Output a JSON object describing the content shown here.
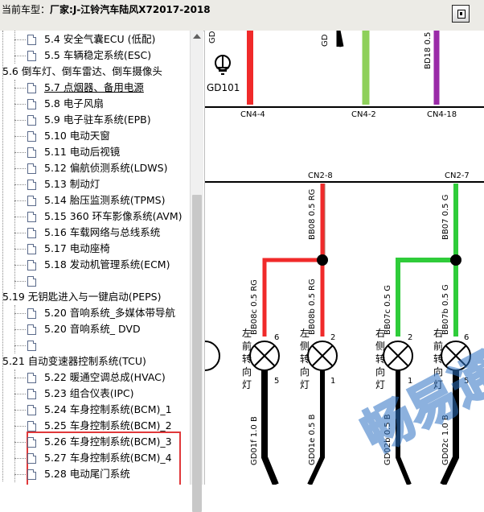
{
  "window": {
    "title_prefix": "当前车型：",
    "title_vehicle": "厂家:J-江铃汽车陆风X72017-2018"
  },
  "tree": [
    {
      "label": "5.4 安全气囊ECU (低配)",
      "indent": 2,
      "y": 0
    },
    {
      "label": "5.5 车辆稳定系统(ESC)",
      "indent": 2,
      "y": 1
    },
    {
      "label": "5.6 倒车灯、倒车雷达、倒车摄像头",
      "indent": 0,
      "y": 2
    },
    {
      "label": "5.7 点烟器、备用电源",
      "indent": 2,
      "y": 3
    },
    {
      "label": "5.8 电子风扇",
      "indent": 2,
      "y": 4
    },
    {
      "label": "5.9 电子驻车系统(EPB)",
      "indent": 2,
      "y": 5
    },
    {
      "label": "5.10 电动天窗",
      "indent": 2,
      "y": 6
    },
    {
      "label": "5.11 电动后视镜",
      "indent": 2,
      "y": 7
    },
    {
      "label": "5.12 偏航侦测系统(LDWS)",
      "indent": 2,
      "y": 8
    },
    {
      "label": "5.13 制动灯",
      "indent": 2,
      "y": 9
    },
    {
      "label": "5.14 胎压监测系统(TPMS)",
      "indent": 2,
      "y": 10
    },
    {
      "label": "5.15 360 环车影像系统(AVM)",
      "indent": 2,
      "y": 11
    },
    {
      "label": "5.16 车载网络与总线系统",
      "indent": 2,
      "y": 12
    },
    {
      "label": "5.17 电动座椅",
      "indent": 2,
      "y": 13
    },
    {
      "label": "5.18 发动机管理系统(ECM)",
      "indent": 2,
      "y": 14
    },
    {
      "label": "",
      "indent": 2,
      "y": 15
    },
    {
      "label": "5.19 无钥匙进入与一键启动(PEPS)",
      "indent": 0,
      "y": 16
    },
    {
      "label": "5.20 音响系统_多媒体带导航",
      "indent": 2,
      "y": 17
    },
    {
      "label": "5.20 音响系统_ DVD",
      "indent": 2,
      "y": 18
    },
    {
      "label": "",
      "indent": 2,
      "y": 19
    },
    {
      "label": "5.21 自动变速器控制系统(TCU)",
      "indent": 0,
      "y": 20
    },
    {
      "label": "5.22 暖通空调总成(HVAC)",
      "indent": 2,
      "y": 21
    },
    {
      "label": "5.23 组合仪表(IPC)",
      "indent": 2,
      "y": 22
    },
    {
      "label": "5.24 车身控制系统(BCM)_1",
      "indent": 2,
      "y": 23
    },
    {
      "label": "5.25 车身控制系统(BCM)_2",
      "indent": 2,
      "y": 24
    },
    {
      "label": "5.26 车身控制系统(BCM)_3",
      "indent": 2,
      "y": 25
    },
    {
      "label": "5.27 车身控制系统(BCM)_4",
      "indent": 2,
      "y": 26
    },
    {
      "label": "5.28 电动尾门系统",
      "indent": 2,
      "y": 27
    }
  ],
  "diagram": {
    "ground_label": "GD101",
    "wire_top_labels": [
      "GD",
      "GD",
      "BD18  0.5  BU"
    ],
    "connectors_top": [
      "CN4-4",
      "CN4-2",
      "CN4-18"
    ],
    "connectors_mid": [
      "CN2-8",
      "CN2-7"
    ],
    "wires_upper": [
      "BB08  0.5  RG",
      "BB07  0.5  G"
    ],
    "wires_branch": [
      "BB08c  0.5  RG",
      "BB08b  0.5  RG",
      "BB07c  0.5  G",
      "BB07b  0.5  G"
    ],
    "lamps": [
      {
        "name": "左前转向灯",
        "pin_top": "6",
        "pin_bottom": "5"
      },
      {
        "name": "左侧转向灯",
        "pin_top": "2",
        "pin_bottom": "1"
      },
      {
        "name": "右侧转向灯",
        "pin_top": "2",
        "pin_bottom": "1"
      },
      {
        "name": "右前转向灯",
        "pin_top": "6",
        "pin_bottom": "5"
      }
    ],
    "wires_lower": [
      "GD01f  1.0  B",
      "GD01e  0.5  B",
      "GD02b  0.5  B",
      "GD02c  1.0  B"
    ],
    "watermark_text": "畅易通"
  },
  "colors": {
    "red_wire": "#f02a2a",
    "green_wire": "#4ccc3a",
    "purple_wire": "#9a2aa8",
    "highlight_box": "#e0383a"
  }
}
